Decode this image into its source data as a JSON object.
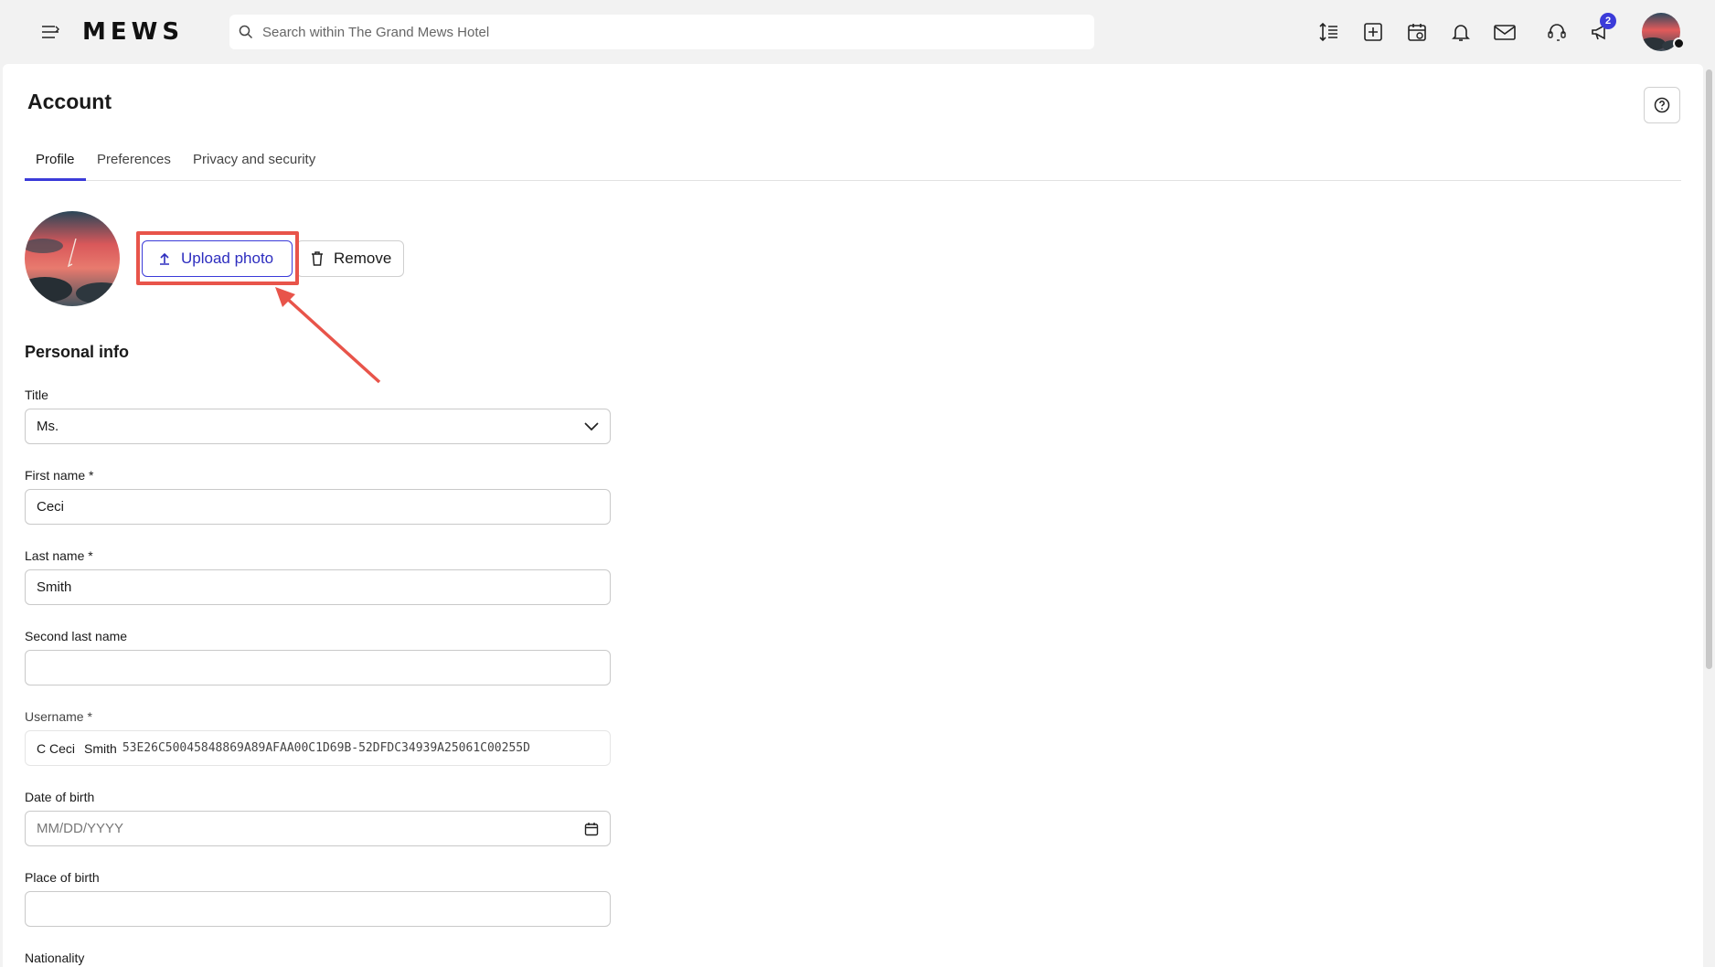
{
  "topbar": {
    "logo": "MEWS",
    "search_placeholder": "Search within The Grand Mews Hotel",
    "notification_badge": "2"
  },
  "page": {
    "title": "Account",
    "tabs": [
      {
        "label": "Profile",
        "active": true
      },
      {
        "label": "Preferences",
        "active": false
      },
      {
        "label": "Privacy and security",
        "active": false
      }
    ]
  },
  "photo": {
    "upload_label": "Upload photo",
    "remove_label": "Remove"
  },
  "personal_info": {
    "section_title": "Personal info",
    "title_label": "Title",
    "title_value": "Ms.",
    "first_name_label": "First name *",
    "first_name_value": "Ceci",
    "last_name_label": "Last name *",
    "last_name_value": "Smith",
    "second_last_name_label": "Second last name",
    "second_last_name_value": "",
    "username_label": "Username *",
    "username_prefix": "C Ceci",
    "username_name": "Smith",
    "username_id": "53E26C50045848869A89AFAA00C1D69B-52DFDC34939A25061C00255D",
    "dob_label": "Date of birth",
    "dob_placeholder": "MM/DD/YYYY",
    "pob_label": "Place of birth",
    "pob_value": "",
    "nationality_label": "Nationality"
  },
  "colors": {
    "accent": "#3b3bd9",
    "annotation": "#e8544a"
  }
}
